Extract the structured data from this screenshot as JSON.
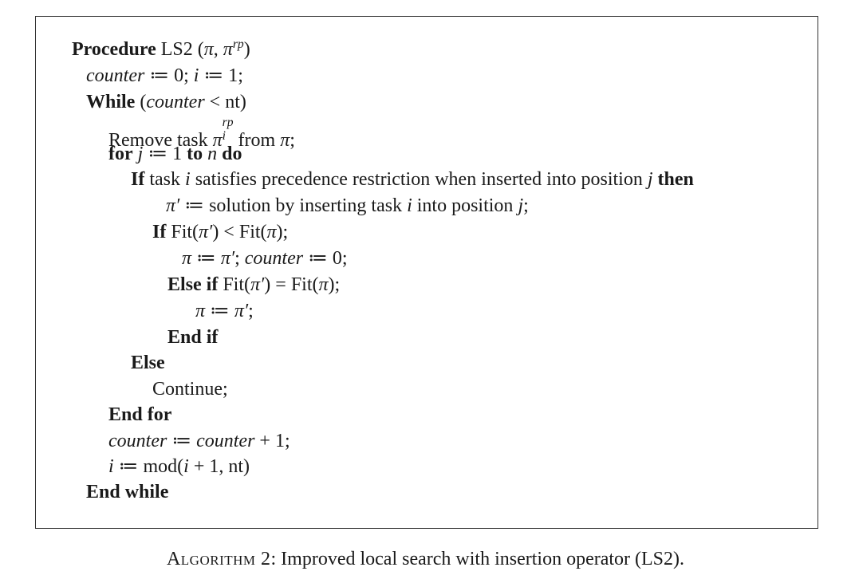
{
  "algorithm": {
    "header": {
      "keyword": "Procedure",
      "name": "LS2",
      "pi": "π",
      "pi_rp": "π",
      "sup_rp": "rp"
    },
    "l_counter_init": {
      "counter": "counter",
      "assign1": " ≔ 0; ",
      "i": "i",
      "assign2": " ≔ 1;"
    },
    "l_while": {
      "keyword": "While",
      "open": " (",
      "counter": "counter",
      "rest": " < nt)"
    },
    "l_remove": {
      "text1": "Remove task ",
      "pi": "π",
      "sup": "rp",
      "sub": "i",
      "text2": " from ",
      "pi2": "π",
      "end": ";"
    },
    "l_for": {
      "kw_for": "for",
      "j": "j",
      "assign": " ≔ 1 ",
      "kw_to": "to",
      "n": "n",
      "kw_do": "do"
    },
    "l_if_task": {
      "kw_if": "If",
      "text1": " task ",
      "i": "i",
      "text2": " satisfies precedence restriction when inserted into position ",
      "j": "j",
      "kw_then": "then"
    },
    "l_pi_prime": {
      "pi_prime": "π′",
      "text1": " ≔ solution by inserting task ",
      "i": "i",
      "text2": " into position ",
      "j": "j",
      "end": ";"
    },
    "l_if_fit": {
      "kw_if": "If",
      "fit1": " Fit(",
      "pi_prime": "π′",
      "mid": ") < Fit(",
      "pi": "π",
      "end": ");"
    },
    "l_assign_pi": {
      "pi": "π",
      "assign": " ≔ ",
      "pi_prime": "π′",
      "sep": "; ",
      "counter": "counter",
      "rest": " ≔ 0;"
    },
    "l_elseif": {
      "kw": "Else if",
      "fit1": " Fit(",
      "pi_prime": "π′",
      "mid": ") = Fit(",
      "pi": "π",
      "end": ");"
    },
    "l_assign_pi2": {
      "pi": "π",
      "assign": " ≔ ",
      "pi_prime": "π′",
      "end": ";"
    },
    "l_endif": {
      "kw": "End if"
    },
    "l_else": {
      "kw": "Else"
    },
    "l_continue": {
      "text": "Continue;"
    },
    "l_endfor": {
      "kw": "End for"
    },
    "l_counter_inc": {
      "counter1": "counter",
      "assign": " ≔ ",
      "counter2": "counter",
      "rest": " + 1;"
    },
    "l_mod": {
      "i": "i",
      "text1": " ≔ mod(",
      "i2": "i",
      "rest": " + 1, nt)"
    },
    "l_endwhile": {
      "kw": "End while"
    }
  },
  "caption": {
    "label": "Algorithm 2",
    "text": ": Improved local search with insertion operator (LS2)."
  }
}
